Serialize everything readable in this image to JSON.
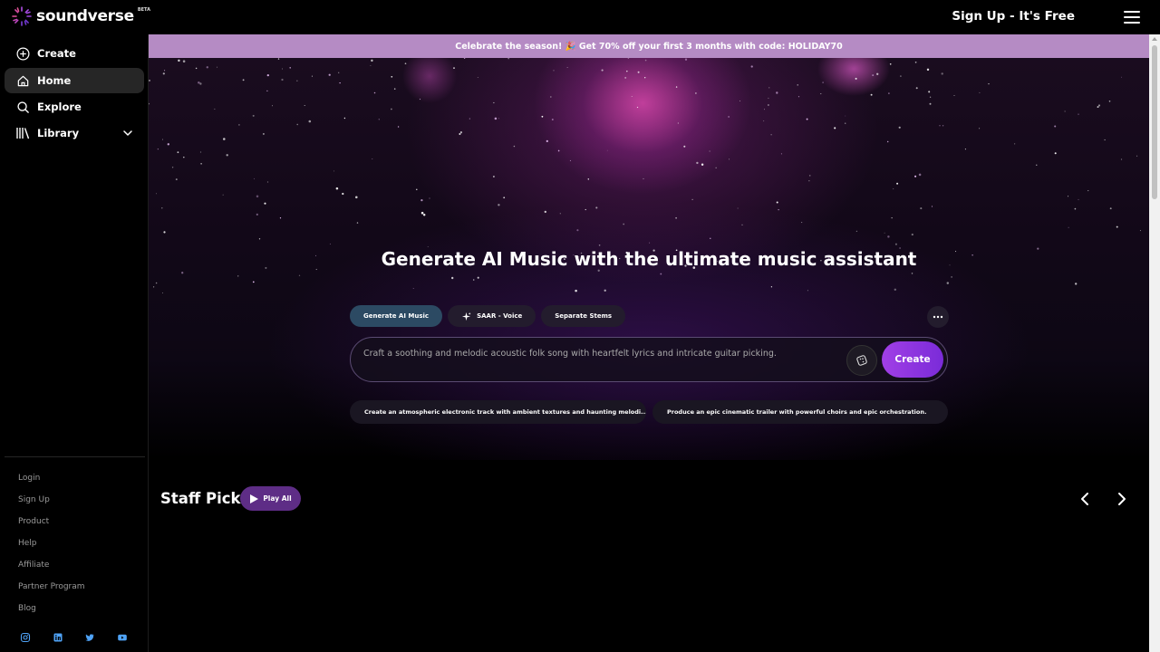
{
  "header": {
    "brand": "soundverse",
    "beta_label": "BETA",
    "signup_label": "Sign Up - It's Free"
  },
  "sidebar": {
    "items": [
      {
        "label": "Create",
        "icon": "plus-circle-icon"
      },
      {
        "label": "Home",
        "icon": "home-icon"
      },
      {
        "label": "Explore",
        "icon": "search-icon"
      },
      {
        "label": "Library",
        "icon": "library-icon"
      }
    ],
    "footer_links": [
      "Login",
      "Sign Up",
      "Product",
      "Help",
      "Affiliate",
      "Partner Program",
      "Blog"
    ],
    "social": [
      "instagram-icon",
      "linkedin-icon",
      "twitter-icon",
      "youtube-icon"
    ]
  },
  "banner": {
    "text": "Celebrate the season! 🎉 Get 70% off your first 3 months with code: HOLIDAY70"
  },
  "hero": {
    "title": "Generate AI Music with the ultimate music assistant",
    "tabs": [
      "Generate AI Music",
      "SAAR - Voice",
      "Separate Stems"
    ],
    "prompt_text": "Craft a soothing and melodic acoustic folk song with heartfelt lyrics and intricate guitar picking.",
    "create_label": "Create",
    "suggestions": [
      "Create an atmospheric electronic track with ambient textures and haunting melodi...",
      "Produce an epic cinematic trailer with powerful choirs and epic orchestration."
    ]
  },
  "staff_picks": {
    "title": "Staff Picks",
    "play_all_label": "Play All"
  },
  "colors": {
    "banner": "#b58bc4",
    "create_button": "#8f36e0",
    "active_tab": "#2c4a63",
    "play_all": "#5e2d86"
  }
}
